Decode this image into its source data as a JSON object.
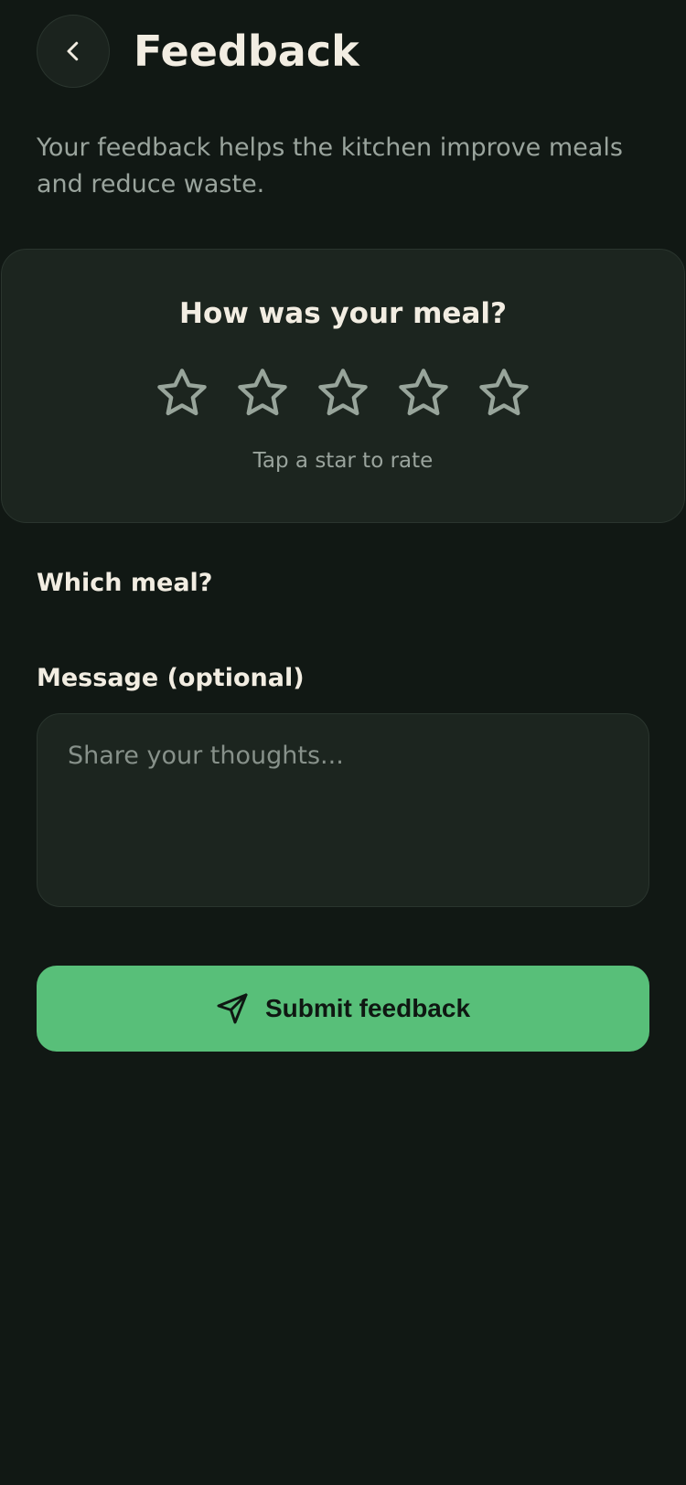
{
  "colors": {
    "background": "#111814",
    "card": "#1c251f",
    "accent": "#58bf79",
    "text_primary": "#f2ede2",
    "text_secondary": "#9aa49d"
  },
  "header": {
    "back_icon": "chevron-left-icon",
    "title": "Feedback"
  },
  "intro_text": "Your feedback helps the kitchen improve meals and reduce waste.",
  "rating": {
    "question": "How was your meal?",
    "max_stars": 5,
    "selected": 0,
    "star_icon": "star-outline-icon",
    "hint": "Tap a star to rate"
  },
  "meal_section": {
    "label": "Which meal?"
  },
  "message_section": {
    "label": "Message (optional)",
    "value": "",
    "placeholder": "Share your thoughts..."
  },
  "submit": {
    "icon": "send-icon",
    "label": "Submit feedback"
  }
}
